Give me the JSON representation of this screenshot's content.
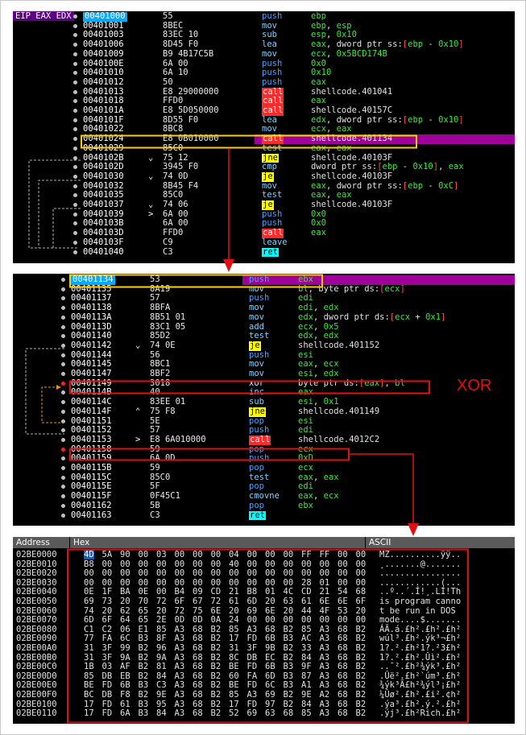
{
  "panel1": {
    "regs": "EIP EAX EDX",
    "rows": [
      {
        "addr": "00401000",
        "bytes": "55",
        "jmp": "",
        "mn": "push",
        "mt": "push",
        "ops": [
          [
            "reg",
            "ebp"
          ]
        ],
        "sel": true
      },
      {
        "addr": "00401001",
        "bytes": "8BEC",
        "jmp": "",
        "mn": "mov",
        "mt": "mov",
        "ops": [
          [
            "reg",
            "ebp"
          ],
          [
            "pl",
            ", "
          ],
          [
            "reg",
            "esp"
          ]
        ]
      },
      {
        "addr": "00401003",
        "bytes": "83EC 10",
        "jmp": "",
        "mn": "sub",
        "mt": "mov",
        "ops": [
          [
            "reg",
            "esp"
          ],
          [
            "pl",
            ", "
          ],
          [
            "num",
            "0x10"
          ]
        ]
      },
      {
        "addr": "00401006",
        "bytes": "8D45 F0",
        "jmp": "",
        "mn": "lea",
        "mt": "mov",
        "ops": [
          [
            "reg",
            "eax"
          ],
          [
            "pl",
            ", dword ptr ss:"
          ],
          [
            "br",
            "["
          ],
          [
            "reg",
            "ebp"
          ],
          [
            "pl",
            " - "
          ],
          [
            "num",
            "0x10"
          ],
          [
            "br",
            "]"
          ]
        ]
      },
      {
        "addr": "00401009",
        "bytes": "B9 4B17C5B",
        "jmp": "",
        "mn": "mov",
        "mt": "mov",
        "ops": [
          [
            "reg",
            "ecx"
          ],
          [
            "pl",
            ", "
          ],
          [
            "num",
            "0x5BCD174B"
          ]
        ]
      },
      {
        "addr": "0040100E",
        "bytes": "6A 00",
        "jmp": "",
        "mn": "push",
        "mt": "push",
        "ops": [
          [
            "num",
            "0x0"
          ]
        ]
      },
      {
        "addr": "00401010",
        "bytes": "6A 10",
        "jmp": "",
        "mn": "push",
        "mt": "push",
        "ops": [
          [
            "num",
            "0x10"
          ]
        ]
      },
      {
        "addr": "00401012",
        "bytes": "50",
        "jmp": "",
        "mn": "push",
        "mt": "push",
        "ops": [
          [
            "reg",
            "eax"
          ]
        ]
      },
      {
        "addr": "00401013",
        "bytes": "E8 29000000",
        "jmp": "",
        "mn": "call",
        "mt": "call",
        "ops": [
          [
            "pl",
            "shellcode.401041"
          ]
        ]
      },
      {
        "addr": "00401018",
        "bytes": "FFD0",
        "jmp": "",
        "mn": "call",
        "mt": "call",
        "ops": [
          [
            "reg",
            "eax"
          ]
        ]
      },
      {
        "addr": "0040101A",
        "bytes": "E8 5D050000",
        "jmp": "",
        "mn": "call",
        "mt": "call",
        "ops": [
          [
            "pl",
            "shellcode.40157C"
          ]
        ]
      },
      {
        "addr": "0040101F",
        "bytes": "8D55 F0",
        "jmp": "",
        "mn": "lea",
        "mt": "mov",
        "ops": [
          [
            "reg",
            "edx"
          ],
          [
            "pl",
            ", dword ptr ss:"
          ],
          [
            "br",
            "["
          ],
          [
            "reg",
            "ebp"
          ],
          [
            "pl",
            " - "
          ],
          [
            "num",
            "0x10"
          ],
          [
            "br",
            "]"
          ]
        ]
      },
      {
        "addr": "00401022",
        "bytes": "8BC8",
        "jmp": "",
        "mn": "mov",
        "mt": "mov",
        "ops": [
          [
            "reg",
            "ecx"
          ],
          [
            "pl",
            ", "
          ],
          [
            "reg",
            "eax"
          ]
        ]
      },
      {
        "addr": "00401024",
        "bytes": "E8 0B010000",
        "jmp": "",
        "mn": "call",
        "mt": "call",
        "ops": [
          [
            "pl",
            "shellcode.401134"
          ]
        ],
        "eip": true
      },
      {
        "addr": "00401029",
        "bytes": "85C0",
        "jmp": "",
        "mn": "test",
        "mt": "mov",
        "ops": [
          [
            "reg",
            "eax"
          ],
          [
            "pl",
            ", "
          ],
          [
            "reg",
            "eax"
          ]
        ]
      },
      {
        "addr": "0040102B",
        "bytes": "75 12",
        "jmp": "v",
        "mn": "jne",
        "mt": "jcc",
        "ops": [
          [
            "pl",
            "shellcode.40103F"
          ]
        ]
      },
      {
        "addr": "0040102D",
        "bytes": "3945 F0",
        "jmp": "",
        "mn": "cmp",
        "mt": "mov",
        "ops": [
          [
            "pl",
            "dword ptr ss:"
          ],
          [
            "br",
            "["
          ],
          [
            "reg",
            "ebp"
          ],
          [
            "pl",
            " - "
          ],
          [
            "num",
            "0x10"
          ],
          [
            "br",
            "]"
          ],
          [
            "pl",
            ", "
          ],
          [
            "reg",
            "eax"
          ]
        ]
      },
      {
        "addr": "00401030",
        "bytes": "74 0D",
        "jmp": "v",
        "mn": "je",
        "mt": "jcc",
        "ops": [
          [
            "pl",
            "shellcode.40103F"
          ]
        ]
      },
      {
        "addr": "00401032",
        "bytes": "8B45 F4",
        "jmp": "",
        "mn": "mov",
        "mt": "mov",
        "ops": [
          [
            "reg",
            "eax"
          ],
          [
            "pl",
            ", dword ptr ss:"
          ],
          [
            "br",
            "["
          ],
          [
            "reg",
            "ebp"
          ],
          [
            "pl",
            " - "
          ],
          [
            "num",
            "0xC"
          ],
          [
            "br",
            "]"
          ]
        ]
      },
      {
        "addr": "00401035",
        "bytes": "85C0",
        "jmp": "",
        "mn": "test",
        "mt": "mov",
        "ops": [
          [
            "reg",
            "eax"
          ],
          [
            "pl",
            ", "
          ],
          [
            "reg",
            "eax"
          ]
        ]
      },
      {
        "addr": "00401037",
        "bytes": "74 06",
        "jmp": "v",
        "mn": "je",
        "mt": "jcc",
        "ops": [
          [
            "pl",
            "shellcode.40103F"
          ]
        ]
      },
      {
        "addr": "00401039",
        "bytes": "6A 00",
        "jmp": ">",
        "mn": "push",
        "mt": "push",
        "ops": [
          [
            "num",
            "0x0"
          ]
        ]
      },
      {
        "addr": "0040103B",
        "bytes": "6A 00",
        "jmp": "",
        "mn": "push",
        "mt": "push",
        "ops": [
          [
            "num",
            "0x0"
          ]
        ]
      },
      {
        "addr": "0040103D",
        "bytes": "FFD0",
        "jmp": "",
        "mn": "call",
        "mt": "call",
        "ops": [
          [
            "reg",
            "eax"
          ]
        ]
      },
      {
        "addr": "0040103F",
        "bytes": "C9",
        "jmp": "",
        "mn": "leave",
        "mt": "mov",
        "ops": []
      },
      {
        "addr": "00401040",
        "bytes": "C3",
        "jmp": "",
        "mn": "ret",
        "mt": "ret",
        "ops": []
      }
    ]
  },
  "panel2": {
    "rows": [
      {
        "addr": "00401134",
        "bytes": "53",
        "jmp": "",
        "mn": "push",
        "mt": "push",
        "ops": [
          [
            "reg",
            "ebx"
          ]
        ],
        "sel": true,
        "eip": true
      },
      {
        "addr": "00401135",
        "bytes": "8A19",
        "jmp": "",
        "mn": "mov",
        "mt": "mov",
        "ops": [
          [
            "reg",
            "bl"
          ],
          [
            "pl",
            ", byte ptr ds:"
          ],
          [
            "br",
            "["
          ],
          [
            "reg",
            "ecx"
          ],
          [
            "br",
            "]"
          ]
        ]
      },
      {
        "addr": "00401137",
        "bytes": "57",
        "jmp": "",
        "mn": "push",
        "mt": "push",
        "ops": [
          [
            "reg",
            "edi"
          ]
        ]
      },
      {
        "addr": "00401138",
        "bytes": "8BFA",
        "jmp": "",
        "mn": "mov",
        "mt": "mov",
        "ops": [
          [
            "reg",
            "edi"
          ],
          [
            "pl",
            ", "
          ],
          [
            "reg",
            "edx"
          ]
        ]
      },
      {
        "addr": "0040113A",
        "bytes": "8B51 01",
        "jmp": "",
        "mn": "mov",
        "mt": "mov",
        "ops": [
          [
            "reg",
            "edx"
          ],
          [
            "pl",
            ", dword ptr ds:"
          ],
          [
            "br",
            "["
          ],
          [
            "reg",
            "ecx"
          ],
          [
            "pl",
            " + "
          ],
          [
            "num",
            "0x1"
          ],
          [
            "br",
            "]"
          ]
        ]
      },
      {
        "addr": "0040113D",
        "bytes": "83C1 05",
        "jmp": "",
        "mn": "add",
        "mt": "mov",
        "ops": [
          [
            "reg",
            "ecx"
          ],
          [
            "pl",
            ", "
          ],
          [
            "num",
            "0x5"
          ]
        ]
      },
      {
        "addr": "00401140",
        "bytes": "85D2",
        "jmp": "",
        "mn": "test",
        "mt": "mov",
        "ops": [
          [
            "reg",
            "edx"
          ],
          [
            "pl",
            ", "
          ],
          [
            "reg",
            "edx"
          ]
        ]
      },
      {
        "addr": "00401142",
        "bytes": "74 0E",
        "jmp": "v",
        "mn": "je",
        "mt": "jcc",
        "ops": [
          [
            "pl",
            "shellcode.401152"
          ]
        ]
      },
      {
        "addr": "00401144",
        "bytes": "56",
        "jmp": "",
        "mn": "push",
        "mt": "push",
        "ops": [
          [
            "reg",
            "esi"
          ]
        ]
      },
      {
        "addr": "00401145",
        "bytes": "8BC1",
        "jmp": "",
        "mn": "mov",
        "mt": "mov",
        "ops": [
          [
            "reg",
            "eax"
          ],
          [
            "pl",
            ", "
          ],
          [
            "reg",
            "ecx"
          ]
        ]
      },
      {
        "addr": "00401147",
        "bytes": "8BF2",
        "jmp": "",
        "mn": "mov",
        "mt": "mov",
        "ops": [
          [
            "reg",
            "esi"
          ],
          [
            "pl",
            ", "
          ],
          [
            "reg",
            "edx"
          ]
        ]
      },
      {
        "addr": "00401149",
        "bytes": "3018",
        "jmp": "",
        "mn": "xor",
        "mt": "xor",
        "ops": [
          [
            "pl",
            "byte ptr ds:"
          ],
          [
            "br",
            "["
          ],
          [
            "reg",
            "eax"
          ],
          [
            "br",
            "]"
          ],
          [
            "pl",
            ", "
          ],
          [
            "reg",
            "bl"
          ]
        ],
        "red": true
      },
      {
        "addr": "0040114B",
        "bytes": "40",
        "jmp": "",
        "mn": "inc",
        "mt": "mov",
        "ops": [
          [
            "reg",
            "eax"
          ]
        ]
      },
      {
        "addr": "0040114C",
        "bytes": "83EE 01",
        "jmp": "",
        "mn": "sub",
        "mt": "mov",
        "ops": [
          [
            "reg",
            "esi"
          ],
          [
            "pl",
            ", "
          ],
          [
            "num",
            "0x1"
          ]
        ]
      },
      {
        "addr": "0040114F",
        "bytes": "75 F8",
        "jmp": "^",
        "mn": "jne",
        "mt": "jcc",
        "ops": [
          [
            "pl",
            "shellcode.401149"
          ]
        ]
      },
      {
        "addr": "00401151",
        "bytes": "5E",
        "jmp": "",
        "mn": "pop",
        "mt": "push",
        "ops": [
          [
            "reg",
            "esi"
          ]
        ]
      },
      {
        "addr": "00401152",
        "bytes": "57",
        "jmp": "",
        "mn": "push",
        "mt": "push",
        "ops": [
          [
            "reg",
            "edi"
          ]
        ]
      },
      {
        "addr": "00401153",
        "bytes": "E8 6A010000",
        "jmp": ">",
        "mn": "call",
        "mt": "call",
        "ops": [
          [
            "pl",
            "shellcode.4012C2"
          ]
        ]
      },
      {
        "addr": "00401158",
        "bytes": "59",
        "jmp": "",
        "mn": "pop",
        "mt": "push",
        "ops": [
          [
            "reg",
            "ecx"
          ]
        ],
        "red": true
      },
      {
        "addr": "00401159",
        "bytes": "6A 0D",
        "jmp": "",
        "mn": "push",
        "mt": "push",
        "ops": [
          [
            "num",
            "0xD"
          ]
        ]
      },
      {
        "addr": "0040115B",
        "bytes": "59",
        "jmp": "",
        "mn": "pop",
        "mt": "push",
        "ops": [
          [
            "reg",
            "ecx"
          ]
        ]
      },
      {
        "addr": "0040115C",
        "bytes": "85C0",
        "jmp": "",
        "mn": "test",
        "mt": "mov",
        "ops": [
          [
            "reg",
            "eax"
          ],
          [
            "pl",
            ", "
          ],
          [
            "reg",
            "eax"
          ]
        ]
      },
      {
        "addr": "0040115E",
        "bytes": "5F",
        "jmp": "",
        "mn": "pop",
        "mt": "push",
        "ops": [
          [
            "reg",
            "edi"
          ]
        ]
      },
      {
        "addr": "0040115F",
        "bytes": "0F45C1",
        "jmp": "",
        "mn": "cmovne",
        "mt": "mov",
        "ops": [
          [
            "reg",
            "eax"
          ],
          [
            "pl",
            ", "
          ],
          [
            "reg",
            "ecx"
          ]
        ]
      },
      {
        "addr": "00401162",
        "bytes": "5B",
        "jmp": "",
        "mn": "pop",
        "mt": "push",
        "ops": [
          [
            "reg",
            "ebx"
          ]
        ]
      },
      {
        "addr": "00401163",
        "bytes": "C3",
        "jmp": "",
        "mn": "ret",
        "mt": "ret",
        "ops": []
      }
    ],
    "xor_label": "XOR"
  },
  "dump": {
    "headers": {
      "address": "Address",
      "hex": "Hex",
      "ascii": "ASCII"
    },
    "rows": [
      {
        "a": "02BE0000",
        "h": "4D 5A 90 00 03 00 00 00 04 00 00 00 FF FF 00 00",
        "s": "MZ..........ÿÿ.."
      },
      {
        "a": "02BE0010",
        "h": "B8 00 00 00 00 00 00 00 40 00 00 00 00 00 00 00",
        "s": "¸.......@......."
      },
      {
        "a": "02BE0020",
        "h": "00 00 00 00 00 00 00 00 00 00 00 00 00 00 00 00",
        "s": "................"
      },
      {
        "a": "02BE0030",
        "h": "00 00 00 00 00 00 00 00 00 00 00 00 28 01 00 00",
        "s": "............(..."
      },
      {
        "a": "02BE0040",
        "h": "0E 1F BA 0E 00 B4 09 CD 21 B8 01 4C CD 21 54 68",
        "s": "..º..´.Í!¸.LÍ!Th"
      },
      {
        "a": "02BE0050",
        "h": "69 73 20 70 72 6F 67 72 61 6D 20 63 61 6E 6E 6F",
        "s": "is program canno"
      },
      {
        "a": "02BE0060",
        "h": "74 20 62 65 20 72 75 6E 20 69 6E 20 44 4F 53 20",
        "s": "t be run in DOS "
      },
      {
        "a": "02BE0070",
        "h": "6D 6F 64 65 2E 0D 0D 0A 24 00 00 00 00 00 00 00",
        "s": "mode....$......."
      },
      {
        "a": "02BE0080",
        "h": "C1 C2 06 E1 85 A3 68 B2 85 A3 68 B2 85 A3 68 B2",
        "s": "ÁÂ.á.£h².£h².£h²"
      },
      {
        "a": "02BE0090",
        "h": "77 FA 6C B3 8F A3 68 B2 17 FD 6B B3 AC A3 68 B2",
        "s": "wúl³.£h².ýk³¬£h²"
      },
      {
        "a": "02BE00A0",
        "h": "31 3F 99 B2 96 A3 68 B2 31 3F 9B B2 33 A3 68 B2",
        "s": "1?.².£h²1?.²3£h²"
      },
      {
        "a": "02BE00B0",
        "h": "31 3F 9A B2 9A A3 68 B2 8C DB EC B2 84 A3 68 B2",
        "s": "1?.².£h².Ûì².£h²"
      },
      {
        "a": "02BE00C0",
        "h": "1B 03 AF B2 81 A3 68 B2 BE FD 6B B3 9F A3 68 B2",
        "s": "..¯².£h²¾ýk³.£h²"
      },
      {
        "a": "02BE00D0",
        "h": "85 DB EB B2 84 A3 68 B2 60 FA 6D B3 87 A3 68 B2",
        "s": ".Ûë².£h²`úm³.£h²"
      },
      {
        "a": "02BE00E0",
        "h": "BE FD 6B B3 C3 A3 68 B2 BE FD 6C B3 A1 A3 68 B2",
        "s": "¾ýk³Ã£h²¾ýl³¡£h²"
      },
      {
        "a": "02BE00F0",
        "h": "BC DB F8 B2 9E A3 68 B2 85 A3 69 B2 9E A2 68 B2",
        "s": "¼Ûø².£h².£i².¢h²"
      },
      {
        "a": "02BE0100",
        "h": "17 FD 61 B3 95 A3 68 B2 17 FD 97 B2 84 A3 68 B2",
        "s": ".ýa³.£h².ý.².£h²"
      },
      {
        "a": "02BE0110",
        "h": "17 FD 6A B3 84 A3 68 B2 52 69 63 68 85 A3 68 B2",
        "s": ".ýj³.£h²Rich.£h²"
      }
    ]
  },
  "colors": {
    "accent_red": "#e01010",
    "highlight_yellow": "#ffcc00",
    "eip_purple": "#a0009a",
    "sel_blue": "#00aaff"
  }
}
